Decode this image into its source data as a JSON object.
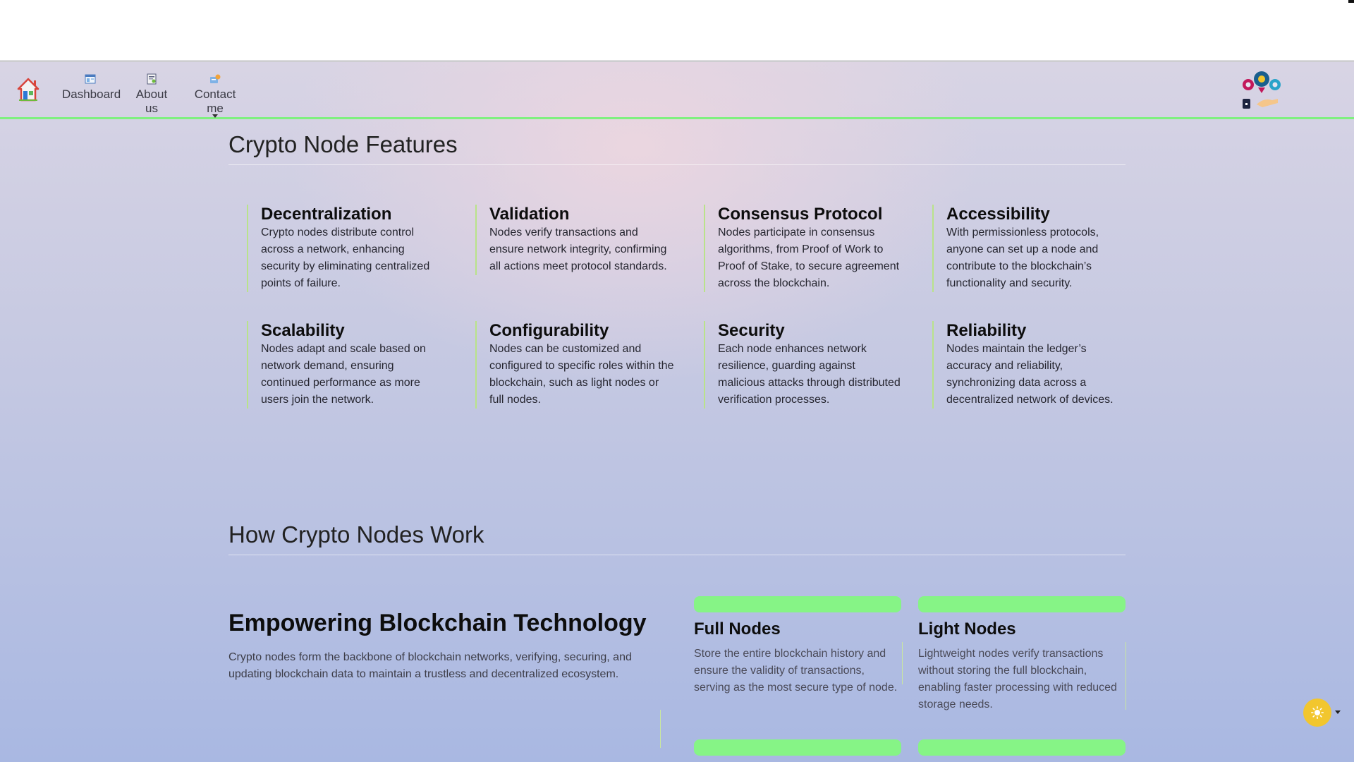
{
  "nav": {
    "home_icon": "home-icon",
    "items": [
      {
        "label": "Dashboard",
        "icon": "dashboard-icon"
      },
      {
        "label": "About us",
        "icon": "about-icon"
      },
      {
        "label": "Contact me",
        "icon": "contact-icon"
      }
    ],
    "brand_icon": "gears-logo-icon"
  },
  "features": {
    "title": "Crypto Node Features",
    "items": [
      {
        "title": "Decentralization",
        "text": "Crypto nodes distribute control across a network, enhancing security by eliminating centralized points of failure."
      },
      {
        "title": "Validation",
        "text": "Nodes verify transactions and ensure network integrity, confirming all actions meet protocol standards."
      },
      {
        "title": "Consensus Protocol",
        "text": "Nodes participate in consensus algorithms, from Proof of Work to Proof of Stake, to secure agreement across the blockchain."
      },
      {
        "title": "Accessibility",
        "text": "With permissionless protocols, anyone can set up a node and contribute to the blockchain’s functionality and security."
      },
      {
        "title": "Scalability",
        "text": "Nodes adapt and scale based on network demand, ensuring continued performance as more users join the network."
      },
      {
        "title": "Configurability",
        "text": "Nodes can be customized and configured to specific roles within the blockchain, such as light nodes or full nodes."
      },
      {
        "title": "Security",
        "text": "Each node enhances network resilience, guarding against malicious attacks through distributed verification processes."
      },
      {
        "title": "Reliability",
        "text": "Nodes maintain the ledger’s accuracy and reliability, synchronizing data across a decentralized network of devices."
      }
    ]
  },
  "how": {
    "title": "How Crypto Nodes Work",
    "hero_title": "Empowering Blockchain Technology",
    "hero_text": "Crypto nodes form the backbone of blockchain networks, verifying, securing, and updating blockchain data to maintain a trustless and decentralized ecosystem.",
    "nodes": [
      {
        "title": "Full Nodes",
        "text": "Store the entire blockchain history and ensure the validity of transactions, serving as the most secure type of node."
      },
      {
        "title": "Light Nodes",
        "text": "Lightweight nodes verify transactions without storing the full blockchain, enabling faster processing with reduced storage needs."
      }
    ]
  },
  "theme_toggle": {
    "icon": "sun-icon",
    "color": "#f2c62e"
  },
  "colors": {
    "accent": "#86f486",
    "nav_border": "#7ff07f",
    "feature_border": "#b9e38a"
  }
}
